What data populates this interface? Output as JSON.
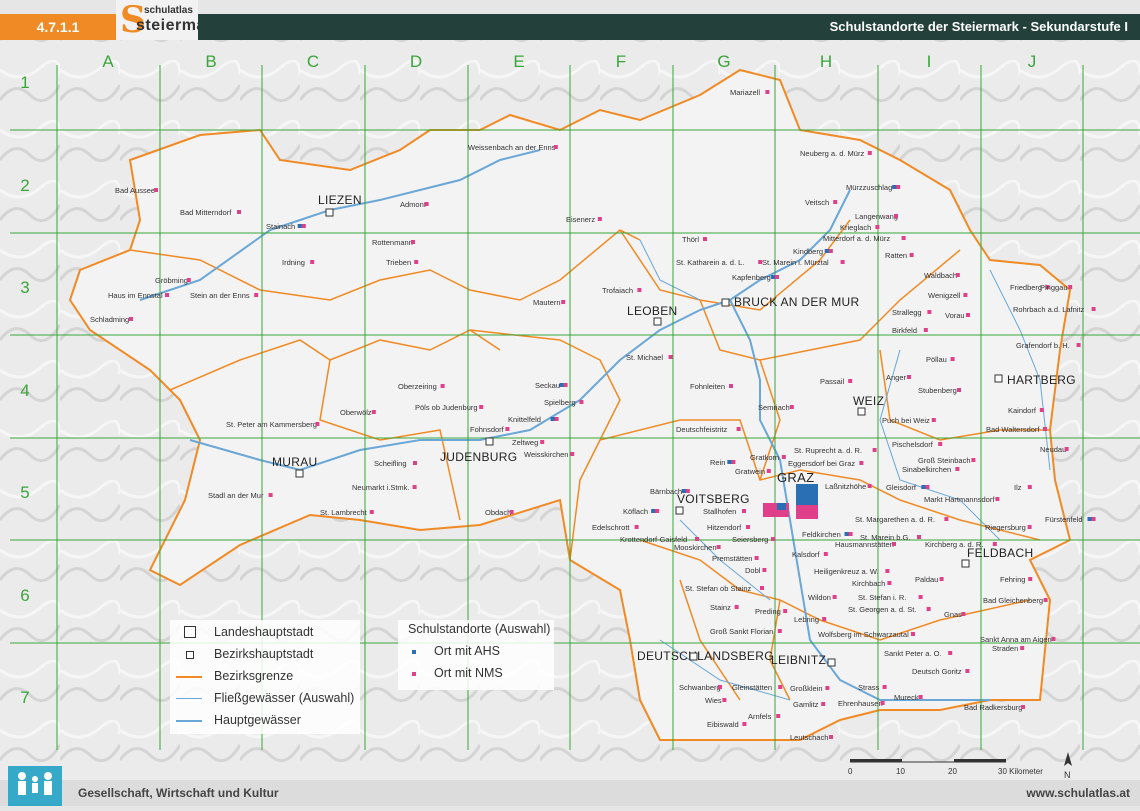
{
  "header": {
    "chapter": "4.7.1.1",
    "logo_top": "schulatlas",
    "logo_main": "steiermark",
    "logo_letter": "S",
    "title": "Schulstandorte der Steiermark - Sekundarstufe I"
  },
  "grid": {
    "columns": [
      "A",
      "B",
      "C",
      "D",
      "E",
      "F",
      "G",
      "H",
      "I",
      "J"
    ],
    "rows": [
      "1",
      "2",
      "3",
      "4",
      "5",
      "6",
      "7"
    ]
  },
  "colors": {
    "border": "#f08a24",
    "grid": "#3aa53a",
    "river": "#6aa6d6",
    "ahs": "#2a6fb4",
    "nms": "#e0408a",
    "header_bar": "#23403a"
  },
  "district_capitals": [
    "LIEZEN",
    "MURAU",
    "JUDENBURG",
    "LEOBEN",
    "BRUCK AN DER MUR",
    "WEIZ",
    "HARTBERG",
    "VOITSBERG",
    "GRAZ",
    "FELDBACH",
    "DEUTSCHLANDSBERG",
    "LEIBNITZ"
  ],
  "places": [
    "Mariazell",
    "Weissenbach an der Enns",
    "Neuberg a. d. Mürz",
    "Mürzzuschlag",
    "Bad Aussee",
    "Bad Mitterndorf",
    "Admont",
    "Eisenerz",
    "Veitsch",
    "Langenwang",
    "Krieglach",
    "Stainach",
    "Rottenmann",
    "Thörl",
    "Mitterdorf a. d. Mürz",
    "Kindberg",
    "Irdning",
    "Trieben",
    "St. Katharein a. d. L.",
    "St. Marein i. Mürztal",
    "Ratten",
    "Gröbming",
    "Haus im Ennstal",
    "Stein an der Enns",
    "Kapfenberg",
    "Trofaiach",
    "Waldbach",
    "Friedberg",
    "Pinggau",
    "Schladming",
    "Mautern",
    "Wenigzell",
    "Rohrbach a.d. Lafnitz",
    "Strallegg",
    "Vorau",
    "Birkfeld",
    "Grafendorf b. H.",
    "St. Michael",
    "Pöllau",
    "Passail",
    "Anger",
    "Oberzeiring",
    "Seckau",
    "Fohnleiten",
    "Stubenberg",
    "Oberwölz",
    "Pöls ob Judenburg",
    "Spielberg",
    "Semriach",
    "Puch bei Weiz",
    "Kaindorf",
    "St. Peter am Kammersberg",
    "Knittelfeld",
    "Deutschfeistritz",
    "Bad Waltersdorf",
    "Fohnsdorf",
    "Zeltweg",
    "Gratkorn",
    "St. Ruprecht a. d. R.",
    "Pischelsdorf",
    "Neudau",
    "Scheifling",
    "Weisskirchen",
    "Rein",
    "Eggersdorf bei Graz",
    "Groß Steinbach",
    "Gratwein",
    "Sinabelkirchen",
    "Neumarkt i.Stmk.",
    "Laßnitzhöhe",
    "Gleisdorf",
    "Stadl an der Mur",
    "Bärnbach",
    "Ilz",
    "Köflach",
    "Markt Hartmannsdorf",
    "St. Lambrecht",
    "Obdach",
    "Stallhofen",
    "Hitzendorf",
    "St. Margarethen a. d. R.",
    "Fürstenfeld",
    "Edelschrott",
    "Riegersburg",
    "Krottendorf-Gaisfeld",
    "Seiersberg",
    "Feldkirchen",
    "St. Marein b.G.",
    "Mooskirchen",
    "Hausmannstätten",
    "Kirchberg a. d. R.",
    "Premstätten",
    "Kalsdorf",
    "Dobl",
    "Heiligenkreuz a. W.",
    "Paldau",
    "St. Stefan ob Stainz",
    "Fehring",
    "Kirchbach",
    "Wildon",
    "St. Stefan i. R.",
    "Bad Gleichenberg",
    "Stainz",
    "Preding",
    "St. Georgen a. d. St.",
    "Gnas",
    "Lebring",
    "Groß Sankt Florian",
    "Wolfsberg im Schwarzautal",
    "Sankt Anna am Aigen",
    "Sankt Peter a. O.",
    "Straden",
    "Deutsch Goritz",
    "Schwanberg",
    "Gleinstätten",
    "Großklein",
    "Strass",
    "Wies",
    "Gamlitz",
    "Ehrenhausen",
    "Mureck",
    "Eibiswald",
    "Bad Radkersburg",
    "Arnfels",
    "Leutschach"
  ],
  "legend": {
    "items": [
      "Landeshauptstadt",
      "Bezirkshauptstadt",
      "Bezirksgrenze",
      "Fließgewässer (Auswahl)",
      "Hauptgewässer"
    ],
    "schools_title": "Schulstandorte (Auswahl)",
    "ahs": "Ort mit AHS",
    "nms": "Ort mit NMS"
  },
  "scale": {
    "ticks": [
      "0",
      "10",
      "20",
      "30 Kilometer"
    ],
    "north": "N"
  },
  "footer": {
    "left": "Gesellschaft, Wirtschaft und Kultur",
    "right": "www.schulatlas.at"
  }
}
